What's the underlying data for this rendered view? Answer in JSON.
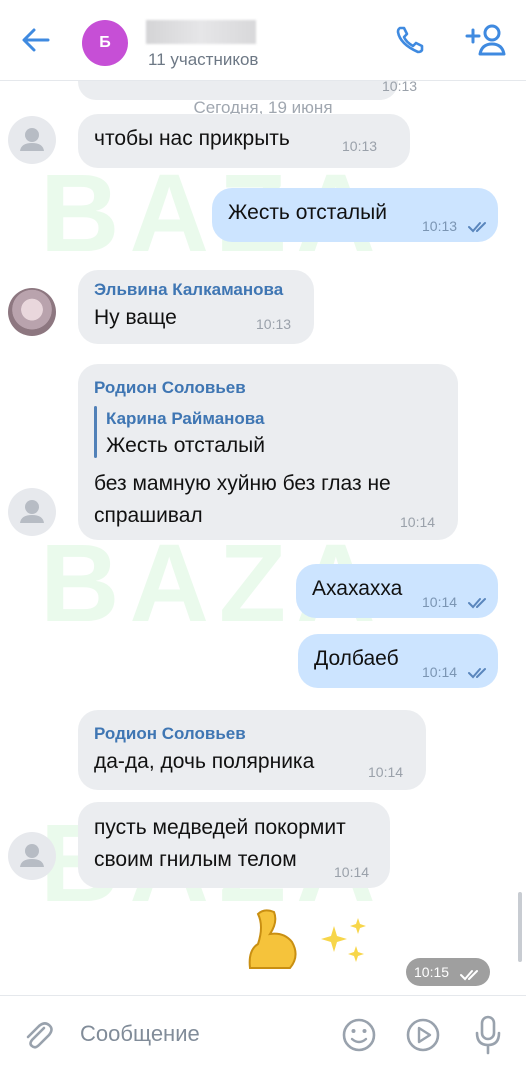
{
  "header": {
    "group_avatar_letter": "Б",
    "participants": "11 участников",
    "icons": {
      "back": "arrow-left-icon",
      "call": "phone-icon",
      "add": "add-user-icon"
    }
  },
  "chat": {
    "prev_time": "10:13",
    "date_separator": "Сегодня, 19 июня",
    "messages": [
      {
        "text": "чтобы нас прикрыть",
        "time": "10:13"
      },
      {
        "text": "Жесть отсталый",
        "time": "10:13",
        "outgoing": true
      },
      {
        "sender": "Эльвина Калкаманова",
        "text": "Ну ваще",
        "time": "10:13"
      },
      {
        "sender": "Родион Соловьев",
        "reply_author": "Карина Райманова",
        "reply_text": "Жесть отсталый",
        "text_line1": "без мамную хуйню без глаз не",
        "text_line2": "спрашивал",
        "time": "10:14"
      },
      {
        "text": "Ахахахха",
        "time": "10:14",
        "outgoing": true
      },
      {
        "text": "Долбаеб",
        "time": "10:14",
        "outgoing": true
      },
      {
        "sender": "Родион Соловьев",
        "text": "да-да, дочь полярника",
        "time": "10:14"
      },
      {
        "text_line1": "пусть медведей покормит",
        "text_line2": "своим гнилым телом",
        "time": "10:14"
      }
    ],
    "sticker_time": "10:15",
    "watermark": "BAZA"
  },
  "input": {
    "placeholder": "Сообщение"
  },
  "colors": {
    "accent": "#3f8ae0",
    "outgoing_bubble": "#cce4ff",
    "incoming_bubble": "#ebedf0",
    "name": "#3f76b3"
  }
}
